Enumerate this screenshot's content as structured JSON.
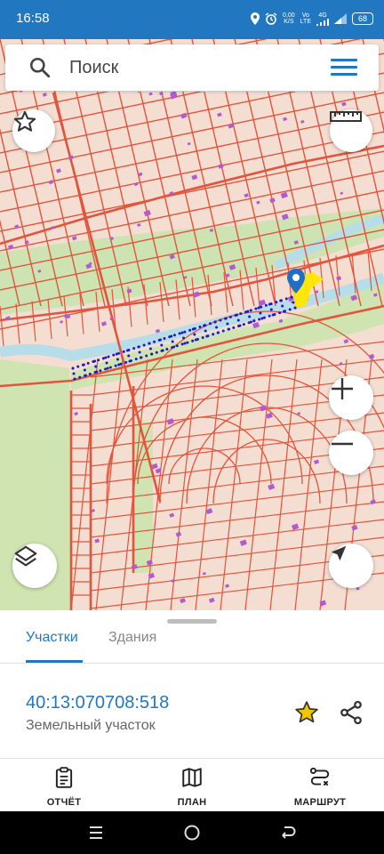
{
  "status_bar": {
    "time": "16:58",
    "net_speed_value": "0,00",
    "net_speed_unit": "K/S",
    "vo_label": "Vo",
    "lte_label": "LTE",
    "network": "4G",
    "battery": "68"
  },
  "search": {
    "placeholder": "Поиск"
  },
  "tabs": [
    {
      "label": "Участки",
      "active": true
    },
    {
      "label": "Здания",
      "active": false
    }
  ],
  "parcel": {
    "cadastral_number": "40:13:070708:518",
    "type": "Земельный участок"
  },
  "bottom_nav": {
    "report_label": "ОТЧЁТ",
    "plan_label": "ПЛАН",
    "route_label": "МАРШРУТ"
  },
  "colors": {
    "accent": "#2178c0",
    "parcel_border": "#e2543c",
    "parcel_fill": "#f4ddd1",
    "forest": "#cfe4b0",
    "water": "#b7dde8",
    "building": "#b15bd0",
    "selection": "#1a1ac8",
    "highlight": "#ffe600",
    "star": "#f2c500"
  },
  "icons": {
    "search": "search-icon",
    "menu": "menu-icon",
    "favorite": "star-icon",
    "ruler": "ruler-icon",
    "layers": "layers-icon",
    "zoom_in": "plus-icon",
    "zoom_out": "minus-icon",
    "locate": "navigation-arrow-icon",
    "share": "share-icon",
    "report": "clipboard-icon",
    "plan": "map-icon",
    "route": "route-icon"
  }
}
